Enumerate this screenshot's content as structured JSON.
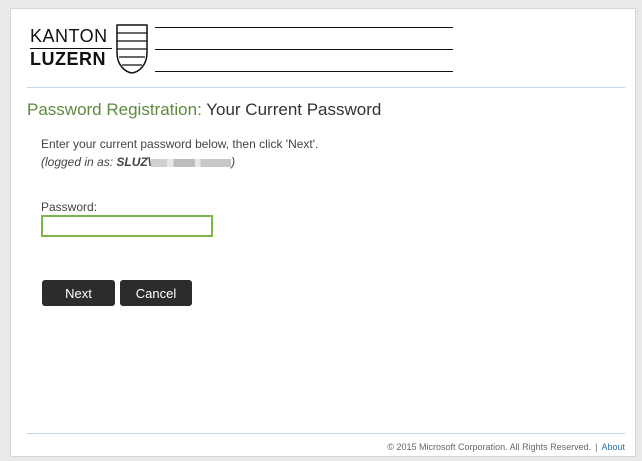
{
  "logo": {
    "line1": "KANTON",
    "line2": "LUZERN"
  },
  "heading": {
    "prefix": "Password Registration:",
    "title": "Your Current Password"
  },
  "instructions": "Enter your current password below, then click 'Next'.",
  "logged_in": {
    "prefix": "(logged in as: ",
    "domain": "SLUZ\\",
    "suffix": ")"
  },
  "form": {
    "password_label": "Password:",
    "password_value": ""
  },
  "buttons": {
    "next": "Next",
    "cancel": "Cancel"
  },
  "footer": {
    "copyright": "© 2015 Microsoft Corporation. All Rights Reserved.",
    "separator": "|",
    "about": "About"
  },
  "colors": {
    "accent_green": "#5d8c3c",
    "input_border": "#7ab648",
    "divider": "#b9dcea",
    "button_bg": "#2c2c2c",
    "link": "#2a6fb1"
  }
}
